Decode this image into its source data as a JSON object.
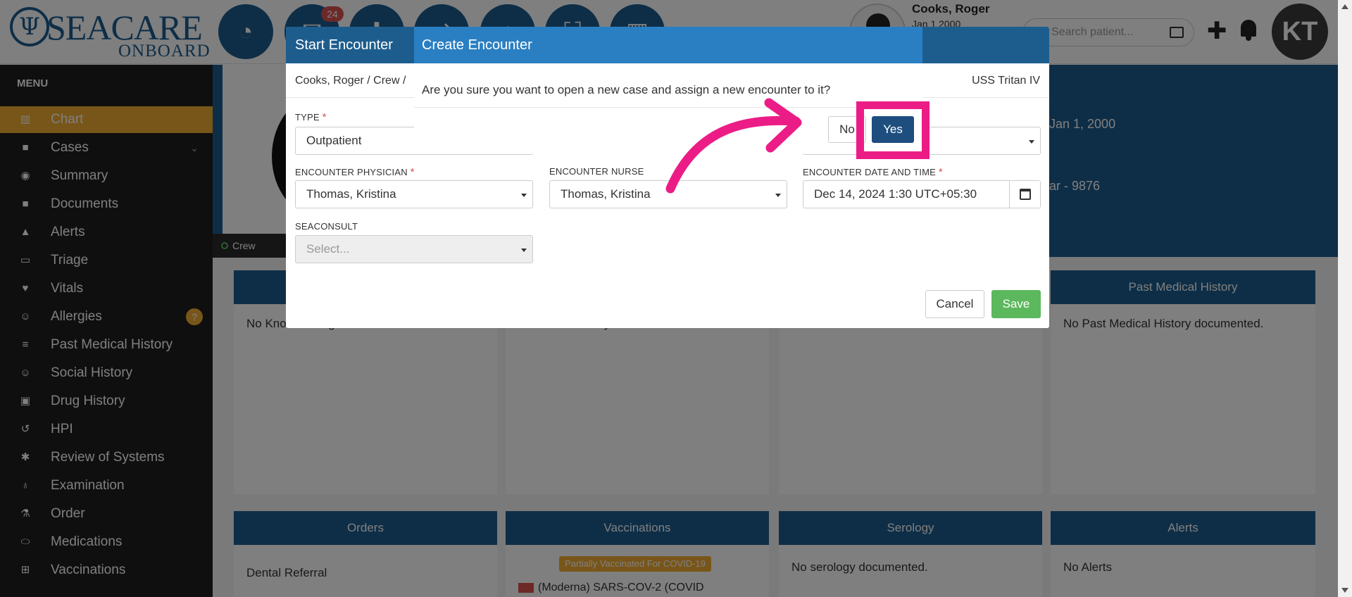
{
  "brand": {
    "logo_word": "SEACARE",
    "logo_sub": "ONBOARD"
  },
  "topbar": {
    "notification_badge": "24",
    "patient_name": "Cooks, Roger",
    "patient_dob": "Jan 1 2000",
    "search_placeholder": "Search patient...",
    "user_initials": "KT"
  },
  "sidebar": {
    "title": "MENU",
    "items": [
      {
        "label": "Chart",
        "icon": "chart-icon",
        "active": true
      },
      {
        "label": "Cases",
        "icon": "folder-icon"
      },
      {
        "label": "Summary",
        "icon": "eye-icon"
      },
      {
        "label": "Documents",
        "icon": "folder-icon"
      },
      {
        "label": "Alerts",
        "icon": "warning-icon"
      },
      {
        "label": "Triage",
        "icon": "inbox-icon"
      },
      {
        "label": "Vitals",
        "icon": "heart-icon"
      },
      {
        "label": "Allergies",
        "icon": "smile-icon",
        "badge": "?"
      },
      {
        "label": "Past Medical History",
        "icon": "list-icon"
      },
      {
        "label": "Social History",
        "icon": "smile-icon"
      },
      {
        "label": "Drug History",
        "icon": "briefcase-icon"
      },
      {
        "label": "HPI",
        "icon": "history-icon"
      },
      {
        "label": "Review of Systems",
        "icon": "gear-icon"
      },
      {
        "label": "Examination",
        "icon": "stethoscope-icon"
      },
      {
        "label": "Order",
        "icon": "flask-icon"
      },
      {
        "label": "Medications",
        "icon": "pill-icon"
      },
      {
        "label": "Vaccinations",
        "icon": "plus-square-icon"
      }
    ]
  },
  "hero": {
    "crew_tag": "Crew",
    "dob_fragment": "Jan 1, 2000",
    "id_fragment": "ar - 9876"
  },
  "cards": {
    "allergies_body": "No Known Allergies",
    "social_body": "No Social History documented.",
    "pmh_title": "Past Medical History",
    "pmh_body": "No Past Medical History documented.",
    "orders_title": "Orders",
    "orders_body": "Dental Referral",
    "vacc_title": "Vaccinations",
    "vacc_badge": "Partially Vaccinated For COVID-19",
    "vacc_line": "(Moderna) SARS-COV-2 (COVID",
    "sero_title": "Serology",
    "sero_body": "No serology documented.",
    "alerts_title": "Alerts",
    "alerts_body": "No Alerts"
  },
  "start_encounter": {
    "title": "Start Encounter",
    "breadcrumb": "Cooks, Roger / Crew /",
    "vessel": "USS Tritan IV",
    "type_label": "TYPE",
    "type_value": "Outpatient",
    "physician_label": "ENCOUNTER PHYSICIAN",
    "physician_value": "Thomas, Kristina",
    "nurse_label": "ENCOUNTER NURSE",
    "nurse_value": "Thomas, Kristina",
    "datetime_label": "ENCOUNTER DATE AND TIME",
    "datetime_value": "Dec 14, 2024 1:30 UTC+05:30",
    "seaconsult_label": "SEACONSULT",
    "seaconsult_placeholder": "Select...",
    "cancel_label": "Cancel",
    "save_label": "Save"
  },
  "create_encounter": {
    "title": "Create Encounter",
    "message": "Are you sure you want to open a new case and assign a new encounter to it?",
    "no_label": "No",
    "yes_label": "Yes"
  },
  "colors": {
    "primary": "#1d5d8e",
    "dialog_header": "#2a7fc2",
    "active_menu": "#f0ad32",
    "save": "#5cb85c",
    "highlight": "#ec1c87"
  }
}
